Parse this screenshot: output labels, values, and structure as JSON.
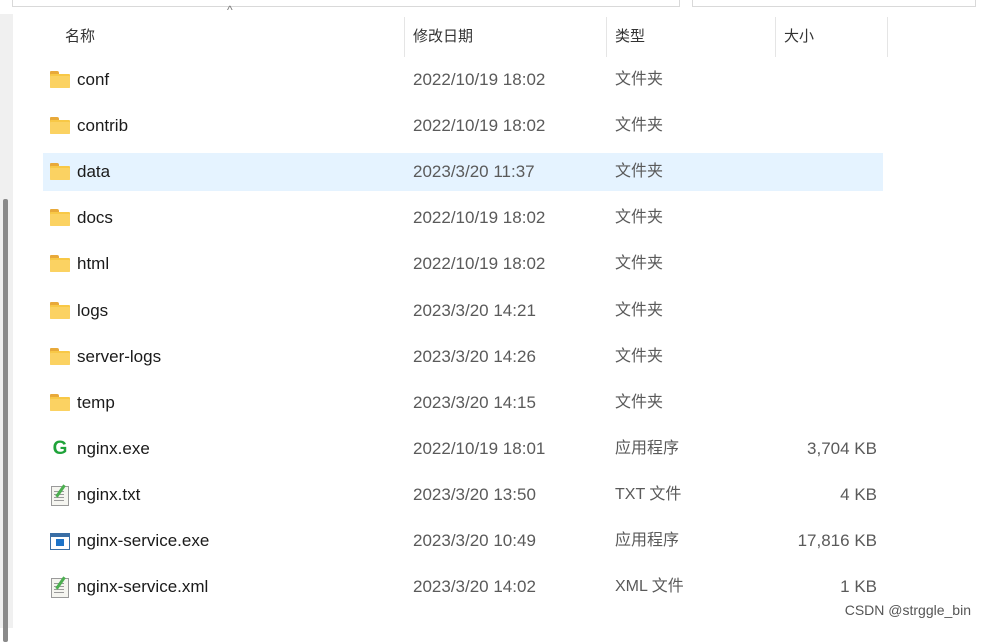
{
  "columns": {
    "name": "名称",
    "date": "修改日期",
    "type": "类型",
    "size": "大小"
  },
  "files": [
    {
      "name": "conf",
      "date": "2022/10/19 18:02",
      "type": "文件夹",
      "size": "",
      "icon": "folder-icon"
    },
    {
      "name": "contrib",
      "date": "2022/10/19 18:02",
      "type": "文件夹",
      "size": "",
      "icon": "folder-icon"
    },
    {
      "name": "data",
      "date": "2023/3/20 11:37",
      "type": "文件夹",
      "size": "",
      "icon": "folder-icon",
      "selected": true
    },
    {
      "name": "docs",
      "date": "2022/10/19 18:02",
      "type": "文件夹",
      "size": "",
      "icon": "folder-icon"
    },
    {
      "name": "html",
      "date": "2022/10/19 18:02",
      "type": "文件夹",
      "size": "",
      "icon": "folder-icon"
    },
    {
      "name": "logs",
      "date": "2023/3/20 14:21",
      "type": "文件夹",
      "size": "",
      "icon": "folder-icon"
    },
    {
      "name": "server-logs",
      "date": "2023/3/20 14:26",
      "type": "文件夹",
      "size": "",
      "icon": "folder-icon"
    },
    {
      "name": "temp",
      "date": "2023/3/20 14:15",
      "type": "文件夹",
      "size": "",
      "icon": "folder-icon"
    },
    {
      "name": "nginx.exe",
      "date": "2022/10/19 18:01",
      "type": "应用程序",
      "size": "3,704 KB",
      "icon": "nginx-app-icon"
    },
    {
      "name": "nginx.txt",
      "date": "2023/3/20 13:50",
      "type": "TXT 文件",
      "size": "4 KB",
      "icon": "text-file-icon"
    },
    {
      "name": "nginx-service.exe",
      "date": "2023/3/20 10:49",
      "type": "应用程序",
      "size": "17,816 KB",
      "icon": "exe-window-icon"
    },
    {
      "name": "nginx-service.xml",
      "date": "2023/3/20 14:02",
      "type": "XML 文件",
      "size": "1 KB",
      "icon": "text-file-icon"
    }
  ],
  "watermark": "CSDN @strggle_bin",
  "colors": {
    "selected_row": "#e5f3ff",
    "folder": "#f8c846",
    "nginx_green": "#1fa33a"
  }
}
